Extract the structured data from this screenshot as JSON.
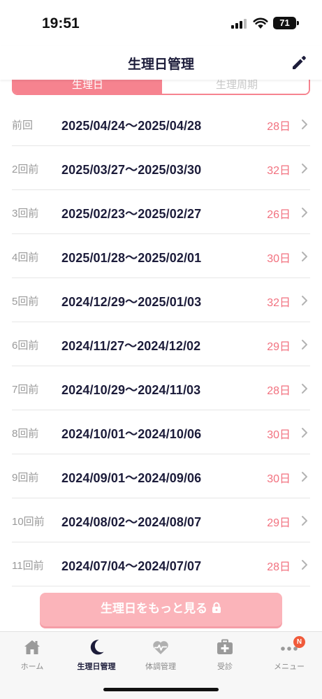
{
  "status_bar": {
    "time": "19:51",
    "battery": "71"
  },
  "header": {
    "title": "生理日管理",
    "edit_icon": "pencil-icon"
  },
  "segment": {
    "left_label": "生理日",
    "right_label": "生理周期"
  },
  "periods": [
    {
      "label": "前回",
      "range": "2025/04/24〜2025/04/28",
      "days": "28",
      "unit": "日"
    },
    {
      "label": "2回前",
      "range": "2025/03/27〜2025/03/30",
      "days": "32",
      "unit": "日"
    },
    {
      "label": "3回前",
      "range": "2025/02/23〜2025/02/27",
      "days": "26",
      "unit": "日"
    },
    {
      "label": "4回前",
      "range": "2025/01/28〜2025/02/01",
      "days": "30",
      "unit": "日"
    },
    {
      "label": "5回前",
      "range": "2024/12/29〜2025/01/03",
      "days": "32",
      "unit": "日"
    },
    {
      "label": "6回前",
      "range": "2024/11/27〜2024/12/02",
      "days": "29",
      "unit": "日"
    },
    {
      "label": "7回前",
      "range": "2024/10/29〜2024/11/03",
      "days": "28",
      "unit": "日"
    },
    {
      "label": "8回前",
      "range": "2024/10/01〜2024/10/06",
      "days": "30",
      "unit": "日"
    },
    {
      "label": "9回前",
      "range": "2024/09/01〜2024/09/06",
      "days": "30",
      "unit": "日"
    },
    {
      "label": "10回前",
      "range": "2024/08/02〜2024/08/07",
      "days": "29",
      "unit": "日"
    },
    {
      "label": "11回前",
      "range": "2024/07/04〜2024/07/07",
      "days": "28",
      "unit": "日"
    }
  ],
  "more_button": {
    "label": "生理日をもっと見る"
  },
  "tabbar": {
    "tabs": [
      {
        "label": "ホーム",
        "icon": "home-icon"
      },
      {
        "label": "生理日管理",
        "icon": "moon-icon"
      },
      {
        "label": "体調管理",
        "icon": "heart-pulse-icon"
      },
      {
        "label": "受診",
        "icon": "medical-kit-icon"
      },
      {
        "label": "メニュー",
        "icon": "more-dots-icon",
        "badge": "N"
      }
    ],
    "active_index": 1
  },
  "colors": {
    "accent_pink": "#f6838f",
    "days_pink": "#f2717f",
    "text_navy": "#1c1c3a",
    "button_pink": "#fbb4ba"
  }
}
